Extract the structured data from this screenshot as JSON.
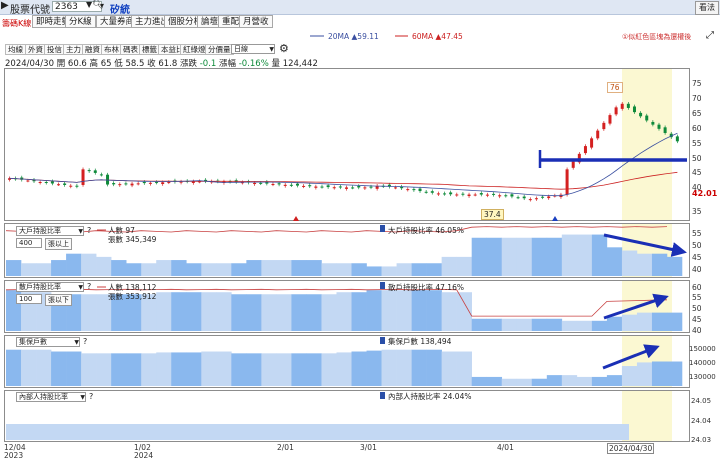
{
  "topbar": {
    "label": "股票代號",
    "stock_code": "2363",
    "stock_name": "矽統",
    "help": "看法"
  },
  "tabs": [
    "即時走勢",
    "分K線",
    "大量券商",
    "主力進出",
    "個股分析",
    "論壇",
    "重配",
    "月營收"
  ],
  "chart_mode_label": "籌碼K線",
  "toolbar": {
    "buttons": [
      "均線",
      "外資",
      "投信",
      "主力",
      "融資",
      "布林",
      "碼表",
      "標籤",
      "本益比",
      "紅綠燈",
      "分價量"
    ],
    "period": "日線"
  },
  "ohlc": {
    "date": "2024/04/30",
    "open": "開 60.6",
    "high": "高 65",
    "low": "低 58.5",
    "close": "收 61.8",
    "chg_label": "漲跌",
    "chg": "-0.1",
    "pct_label": "漲幅",
    "pct": "-0.16%",
    "vol_label": "量",
    "vol": "124,442"
  },
  "ma_legend": {
    "ma20": "20MA ▲59.11",
    "ma60": "60MA ▲47.45"
  },
  "notice": "①似紅色區塊為還權後",
  "colors": {
    "up": "#d42020",
    "down": "#0e8a3a",
    "ma20": "#3a4fa0",
    "ma60": "#cc2222",
    "highlight": "#fbf8d2",
    "area": "#8ab8ee",
    "area_light": "#c3d8f3",
    "line_red": "#c84040",
    "mark_blue": "#1a2fb5"
  },
  "price_panel": {
    "y_ticks": [
      "75",
      "70",
      "65",
      "60",
      "55",
      "50",
      "45",
      "40",
      "35"
    ],
    "right_value": "42.01",
    "high_label": "76",
    "low_label": "37.4",
    "ylim": [
      32,
      80
    ]
  },
  "panel1": {
    "select": "大戶持股比率",
    "input": "400",
    "unit": "張以上",
    "legend_left1": "人數 97",
    "legend_left2": "張數 345,349",
    "legend_right": "大戶持股比率 46.05%",
    "y_ticks": [
      "55",
      "50",
      "45",
      "40"
    ]
  },
  "panel2": {
    "select": "散戶持股比率",
    "input": "100",
    "unit": "張以下",
    "legend_left1": "人數 138,112",
    "legend_left2": "張數 353,912",
    "legend_right": "散戶持股比率 47.16%",
    "y_ticks": [
      "60",
      "55",
      "50",
      "45",
      "40"
    ]
  },
  "panel3": {
    "select": "集保戶數",
    "legend_right": "集保戶數 138,494",
    "y_ticks": [
      "150000",
      "140000",
      "130000"
    ]
  },
  "panel4": {
    "select": "內部人持股比率",
    "legend_right": "內部人持股比率 24.04%",
    "y_ticks": [
      "24.05",
      "24.04",
      "24.03"
    ]
  },
  "x_axis": {
    "labels": [
      "12/04",
      "1/02",
      "2/01",
      "3/01",
      "4/01"
    ],
    "years": [
      "2023",
      "2024"
    ],
    "current": "2024/04/30"
  },
  "chart_data": [
    {
      "type": "candlestick",
      "title": "",
      "x_labels": [
        "12/04",
        "1/02",
        "2/01",
        "3/01",
        "4/01",
        "2024/04/30"
      ],
      "annotations": [
        "76",
        "37.4",
        "42.01"
      ],
      "series": [
        {
          "name": "20MA ▲59.11",
          "last": 59.11
        },
        {
          "name": "60MA ▲47.45",
          "last": 47.45
        }
      ],
      "ylim": [
        32,
        80
      ]
    },
    {
      "type": "area",
      "title": "大戶持股比率 46.05%",
      "values": [
        45,
        44,
        44,
        45,
        47,
        47,
        46,
        45,
        44,
        44,
        45,
        45,
        44,
        44,
        44,
        44,
        45,
        45,
        45,
        45,
        45,
        44,
        44,
        44,
        43,
        43,
        44,
        44,
        44,
        46,
        46,
        52,
        52,
        52,
        52,
        52,
        52,
        53,
        53,
        53,
        49,
        48,
        47,
        47,
        46
      ],
      "ylim": [
        40,
        56
      ]
    },
    {
      "type": "area",
      "title": "散戶持股比率 47.16%",
      "values": [
        58,
        57,
        57,
        56,
        56,
        56,
        56,
        56,
        56,
        56,
        57,
        57,
        57,
        57,
        57,
        56,
        56,
        56,
        56,
        56,
        56,
        56,
        57,
        57,
        58,
        58,
        58,
        58,
        58,
        57,
        57,
        44,
        44,
        44,
        44,
        44,
        44,
        43,
        43,
        43,
        45,
        46,
        47,
        47,
        47
      ],
      "ylim": [
        38,
        62
      ]
    },
    {
      "type": "area",
      "title": "集保戶數 138,494",
      "values": [
        145000,
        145000,
        145000,
        144000,
        144000,
        143000,
        143000,
        143000,
        143000,
        143000,
        143500,
        143500,
        143500,
        144000,
        144000,
        143000,
        143000,
        143000,
        143000,
        143000,
        143000,
        143000,
        143500,
        144000,
        144500,
        145000,
        145000,
        145000,
        145000,
        144000,
        144000,
        130000,
        130000,
        129000,
        129000,
        129000,
        131000,
        131000,
        130000,
        130000,
        131000,
        136000,
        138000,
        138500,
        138494
      ],
      "ylim": [
        125000,
        152000
      ]
    },
    {
      "type": "area",
      "title": "內部人持股比率 24.04%",
      "values": [
        24.04
      ],
      "ylim": [
        24.03,
        24.05
      ]
    }
  ]
}
